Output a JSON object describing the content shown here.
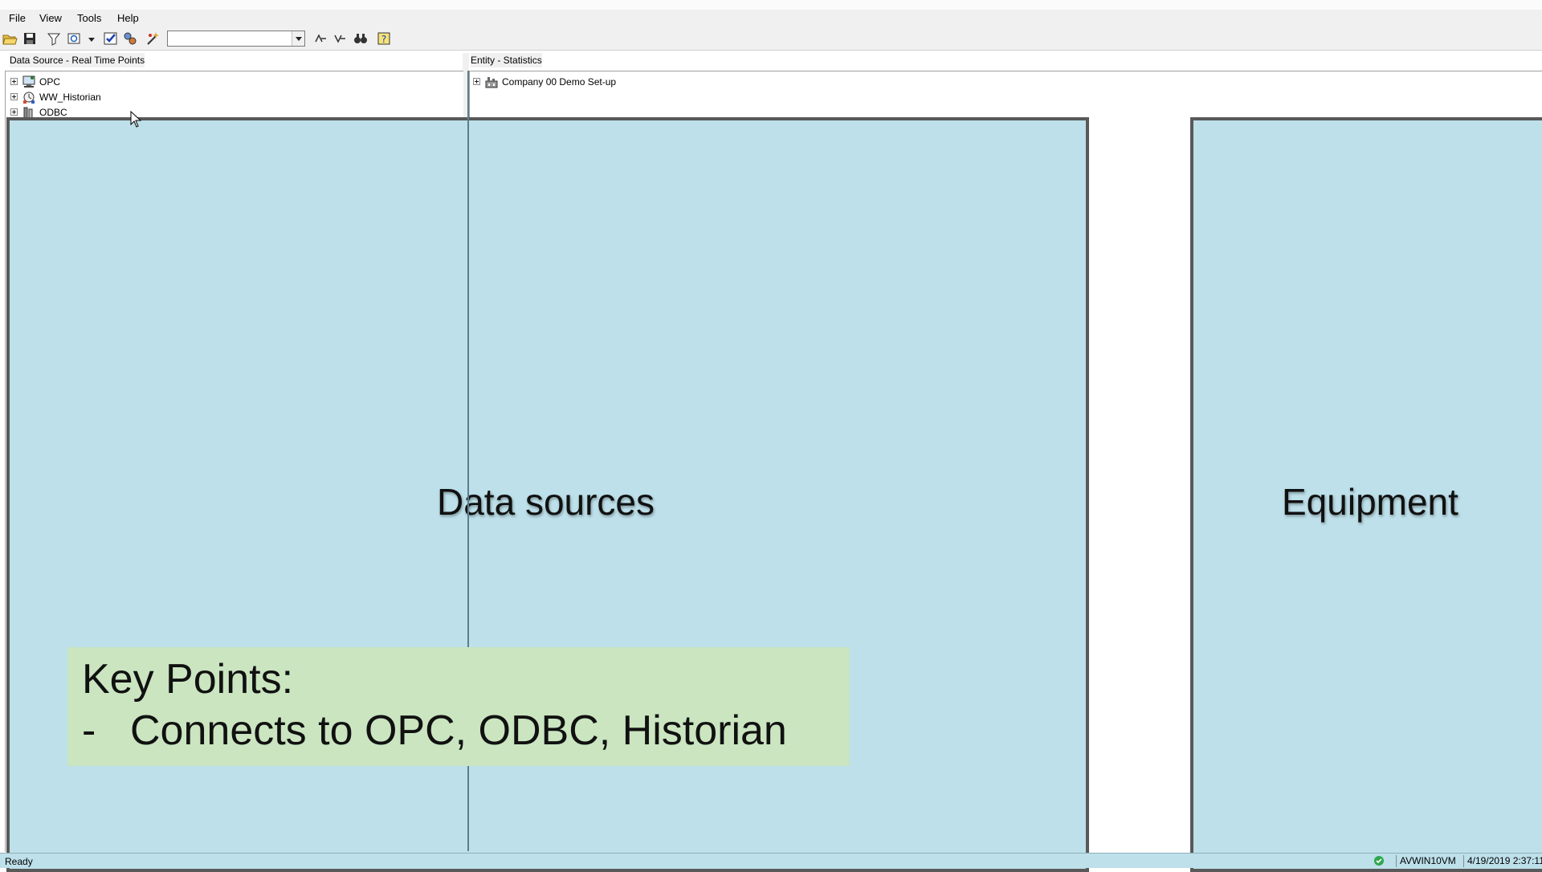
{
  "menu": {
    "items": [
      "File",
      "View",
      "Tools",
      "Help"
    ]
  },
  "toolbar": {
    "combo_value": "",
    "icons": [
      "open-folder-icon",
      "save-icon",
      "filter-icon",
      "refresh-icon",
      "dropdown-arrow-icon",
      "checkmark-icon",
      "gears-icon",
      "wizard-icon",
      "nav-up-icon",
      "nav-down-icon",
      "binoculars-icon",
      "help-icon"
    ]
  },
  "left_pane": {
    "header": "Data Source - Real Time Points",
    "items": [
      {
        "label": "OPC",
        "icon": "opc-server-icon"
      },
      {
        "label": "WW_Historian",
        "icon": "historian-icon"
      },
      {
        "label": "ODBC",
        "icon": "database-icon"
      }
    ]
  },
  "right_pane": {
    "header": "Entity - Statistics",
    "items": [
      {
        "label": "Company  00  Demo Set-up",
        "icon": "factory-icon"
      }
    ]
  },
  "overlay": {
    "data_sources": "Data sources",
    "equipment": "Equipment",
    "key_points_heading": "Key Points:",
    "key_points_bullet": "-",
    "key_points_item": "Connects to OPC, ODBC, Historian"
  },
  "status": {
    "text": "Ready",
    "machine": "AVWIN10VM",
    "datetime": "4/19/2019 2:37:11",
    "ok_icon": "green-check-icon"
  },
  "colors": {
    "overlay_fill": "#bde0ea",
    "overlay_border": "#595959",
    "key_points_fill": "#cae5c0"
  }
}
